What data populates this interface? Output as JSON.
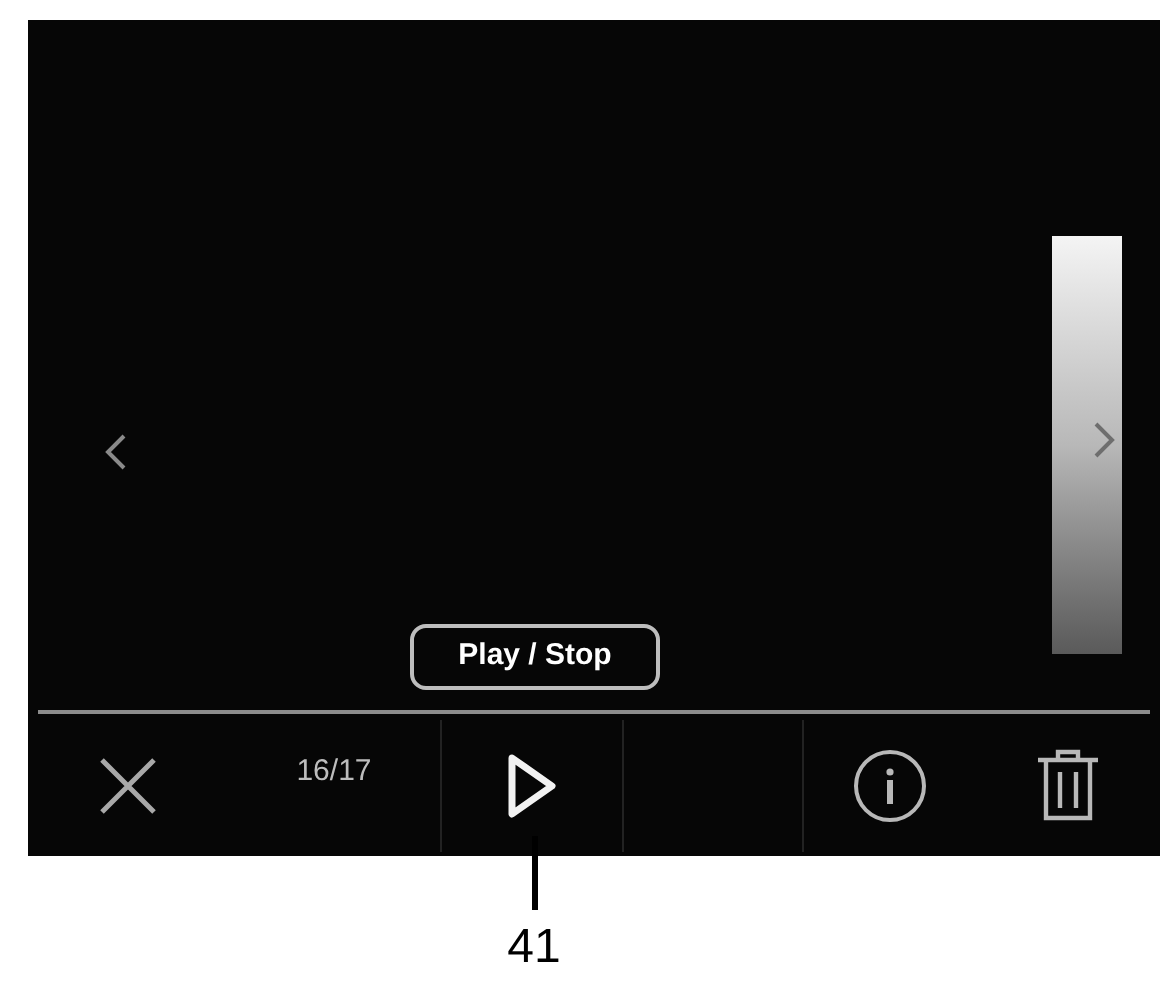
{
  "overlay_button": {
    "label": "Play / Stop"
  },
  "toolbar": {
    "counter": "16/17"
  },
  "callout": {
    "label": "41"
  }
}
